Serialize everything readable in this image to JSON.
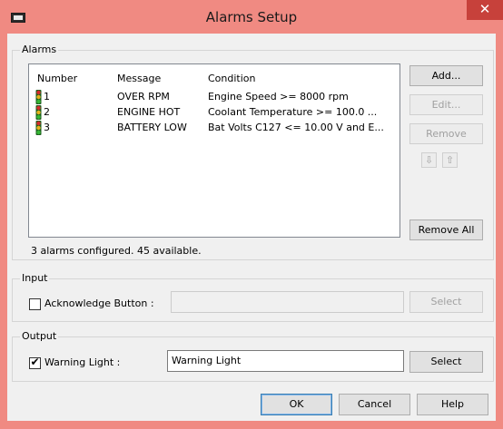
{
  "window": {
    "title": "Alarms Setup",
    "close_glyph": "✕"
  },
  "alarms_group": {
    "label": "Alarms",
    "columns": [
      "Number",
      "Message",
      "Condition"
    ],
    "rows": [
      {
        "number": "1",
        "message": "OVER RPM",
        "condition": "Engine Speed >= 8000 rpm"
      },
      {
        "number": "2",
        "message": "ENGINE HOT",
        "condition": "Coolant Temperature >= 100.0 ..."
      },
      {
        "number": "3",
        "message": "BATTERY LOW",
        "condition": "Bat Volts C127 <= 10.00 V and E..."
      }
    ],
    "status": "3 alarms configured. 45 available.",
    "buttons": {
      "add": "Add...",
      "edit": "Edit...",
      "remove": "Remove",
      "move_down": "⇩",
      "move_up": "⇧",
      "remove_all": "Remove All"
    }
  },
  "input_group": {
    "label": "Input",
    "acknowledge_label": "Acknowledge Button :",
    "acknowledge_checked": false,
    "acknowledge_value": "",
    "select": "Select"
  },
  "output_group": {
    "label": "Output",
    "warning_label": "Warning Light :",
    "warning_checked": true,
    "warning_value": "Warning Light",
    "select": "Select",
    "check_glyph": "✔"
  },
  "footer": {
    "ok": "OK",
    "cancel": "Cancel",
    "help": "Help"
  },
  "colors": {
    "title_bar": "#f08a82",
    "close": "#c7413b",
    "dialog_bg": "#f0f0f0"
  }
}
